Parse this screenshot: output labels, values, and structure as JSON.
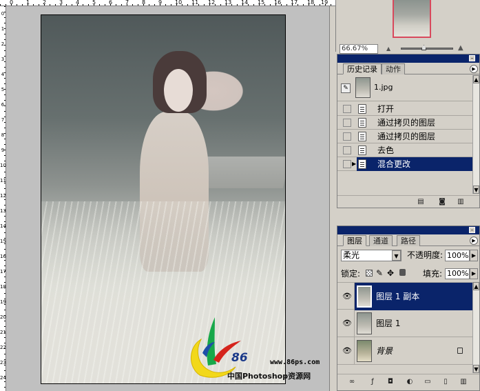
{
  "ruler": {
    "top_labels": [
      "0",
      "1",
      "2",
      "3",
      "4",
      "5",
      "6",
      "7",
      "8",
      "9",
      "10",
      "11",
      "12",
      "13",
      "14",
      "15",
      "16",
      "17",
      "18",
      "19"
    ],
    "left_labels": [
      "0",
      "1",
      "2",
      "3",
      "4",
      "5",
      "6",
      "7",
      "8",
      "9",
      "10",
      "11",
      "12",
      "13",
      "14",
      "15",
      "16",
      "17",
      "18",
      "19",
      "20",
      "21",
      "22",
      "23",
      "24"
    ]
  },
  "navigator": {
    "zoom_value": "66.67%",
    "zoom_out_icon": "mountain-small-icon",
    "zoom_in_icon": "mountain-large-icon"
  },
  "history_panel": {
    "tabs": [
      {
        "label": "历史记录",
        "active": true
      },
      {
        "label": "动作",
        "active": false
      }
    ],
    "snapshot": {
      "label": "1.jpg"
    },
    "steps": [
      {
        "label": "打开",
        "selected": false
      },
      {
        "label": "通过拷贝的图层",
        "selected": false
      },
      {
        "label": "通过拷贝的图层",
        "selected": false
      },
      {
        "label": "去色",
        "selected": false
      },
      {
        "label": "混合更改",
        "selected": true
      }
    ],
    "footer_icons": [
      "new-document-from-state-icon",
      "snapshot-camera-icon",
      "trash-icon"
    ]
  },
  "layers_panel": {
    "tabs": [
      {
        "label": "图层",
        "active": true
      },
      {
        "label": "通道",
        "active": false
      },
      {
        "label": "路径",
        "active": false
      }
    ],
    "blend_mode": "柔光",
    "opacity_label": "不透明度:",
    "opacity_value": "100%",
    "lock_label": "锁定:",
    "fill_label": "填充:",
    "fill_value": "100%",
    "layers": [
      {
        "name": "图层 1 副本",
        "selected": true,
        "visible": true,
        "italic": false,
        "locked": false
      },
      {
        "name": "图层 1",
        "selected": false,
        "visible": true,
        "italic": false,
        "locked": false
      },
      {
        "name": "背景",
        "selected": false,
        "visible": true,
        "italic": true,
        "locked": true
      }
    ],
    "footer_icons": [
      "link-icon",
      "layer-style-icon",
      "mask-icon",
      "adjustment-layer-icon",
      "new-group-icon",
      "new-layer-icon",
      "trash-icon"
    ]
  },
  "watermark": {
    "logo_text": "86",
    "url": "www.86ps.com",
    "site_name": "中国Photoshop资源网"
  },
  "colors": {
    "titlebar": "#0a246a",
    "selection": "#0a246a",
    "panel_bg": "#d4d0c8",
    "canvas_bg": "#c0c0c0"
  }
}
